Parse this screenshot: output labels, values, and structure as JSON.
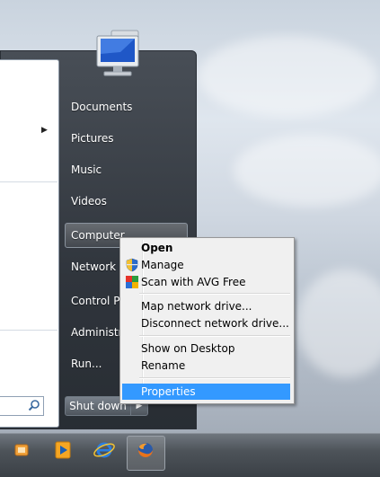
{
  "start_menu": {
    "right_items": [
      {
        "label": "Documents"
      },
      {
        "label": "Pictures"
      },
      {
        "label": "Music"
      },
      {
        "label": "Videos"
      },
      {
        "label": "Computer"
      },
      {
        "label": "Network"
      },
      {
        "label": "Control Pa"
      },
      {
        "label": "Administra"
      },
      {
        "label": "Run..."
      }
    ],
    "shutdown_label": "Shut down"
  },
  "context_menu": {
    "items": [
      {
        "label": "Open",
        "bold": true
      },
      {
        "label": "Manage",
        "icon": "shield-icon"
      },
      {
        "label": "Scan with AVG Free",
        "icon": "avg-icon"
      },
      {
        "label": "Map network drive..."
      },
      {
        "label": "Disconnect network drive..."
      },
      {
        "label": "Show on Desktop"
      },
      {
        "label": "Rename"
      },
      {
        "label": "Properties",
        "highlighted": true
      }
    ]
  },
  "taskbar": {
    "icons": [
      "windows-explorer-icon",
      "media-player-icon",
      "internet-explorer-icon",
      "firefox-icon"
    ]
  },
  "colors": {
    "highlight": "#3399ff",
    "menu_bg": "#f0f0f0"
  }
}
